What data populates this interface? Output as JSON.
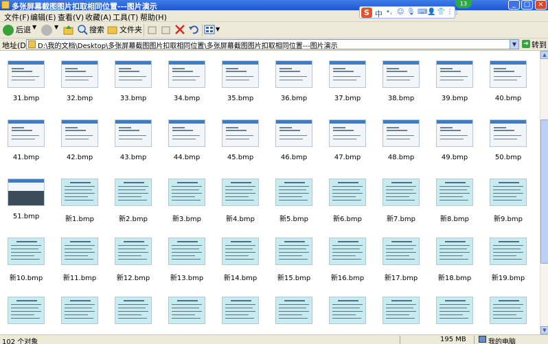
{
  "window": {
    "title": "多张屏幕截图图片扣取相同位置---图片演示",
    "tray_badge": "13",
    "buttons": {
      "minimize": "_",
      "maximize": "□",
      "close": "×"
    }
  },
  "menu": {
    "items": [
      "文件(F)",
      "编辑(E)",
      "查看(V)",
      "收藏(A)",
      "工具(T)",
      "帮助(H)"
    ]
  },
  "ime": {
    "logo": "S",
    "mode": "中",
    "glyphs": [
      "•,",
      "☺",
      "🎙",
      "⌨",
      "👤",
      "👕",
      "⋮⋮"
    ]
  },
  "toolbar": {
    "back": "后退",
    "search": "搜索",
    "folders": "文件夹",
    "views_icon": "views-icon"
  },
  "address": {
    "label": "地址(D)",
    "path": "D:\\我的文档\\Desktop\\多张屏幕截图图片扣取相同位置\\多张屏幕截图图片扣取相同位置---图片演示",
    "go": "转到"
  },
  "files": [
    {
      "name": "31.bmp",
      "kind": "shot"
    },
    {
      "name": "32.bmp",
      "kind": "shot"
    },
    {
      "name": "33.bmp",
      "kind": "shot"
    },
    {
      "name": "34.bmp",
      "kind": "shot"
    },
    {
      "name": "35.bmp",
      "kind": "shot"
    },
    {
      "name": "36.bmp",
      "kind": "shot"
    },
    {
      "name": "37.bmp",
      "kind": "shot"
    },
    {
      "name": "38.bmp",
      "kind": "shot"
    },
    {
      "name": "39.bmp",
      "kind": "shot"
    },
    {
      "name": "40.bmp",
      "kind": "shot"
    },
    {
      "name": "41.bmp",
      "kind": "shot"
    },
    {
      "name": "42.bmp",
      "kind": "shot"
    },
    {
      "name": "43.bmp",
      "kind": "shot"
    },
    {
      "name": "44.bmp",
      "kind": "shot"
    },
    {
      "name": "45.bmp",
      "kind": "shot"
    },
    {
      "name": "46.bmp",
      "kind": "shot"
    },
    {
      "name": "47.bmp",
      "kind": "shot"
    },
    {
      "name": "48.bmp",
      "kind": "shot"
    },
    {
      "name": "49.bmp",
      "kind": "shot"
    },
    {
      "name": "50.bmp",
      "kind": "shot"
    },
    {
      "name": "51.bmp",
      "kind": "dark"
    },
    {
      "name": "新1.bmp",
      "kind": "slide"
    },
    {
      "name": "新2.bmp",
      "kind": "slide"
    },
    {
      "name": "新3.bmp",
      "kind": "slide"
    },
    {
      "name": "新4.bmp",
      "kind": "slide"
    },
    {
      "name": "新5.bmp",
      "kind": "slide"
    },
    {
      "name": "新6.bmp",
      "kind": "slide"
    },
    {
      "name": "新7.bmp",
      "kind": "slide"
    },
    {
      "name": "新8.bmp",
      "kind": "slide"
    },
    {
      "name": "新9.bmp",
      "kind": "slide"
    },
    {
      "name": "新10.bmp",
      "kind": "slide"
    },
    {
      "name": "新11.bmp",
      "kind": "slide"
    },
    {
      "name": "新12.bmp",
      "kind": "slide"
    },
    {
      "name": "新13.bmp",
      "kind": "slide"
    },
    {
      "name": "新14.bmp",
      "kind": "slide"
    },
    {
      "name": "新15.bmp",
      "kind": "slide"
    },
    {
      "name": "新16.bmp",
      "kind": "slide"
    },
    {
      "name": "新17.bmp",
      "kind": "slide"
    },
    {
      "name": "新18.bmp",
      "kind": "slide"
    },
    {
      "name": "新19.bmp",
      "kind": "slide"
    },
    {
      "name": "",
      "kind": "slide"
    },
    {
      "name": "",
      "kind": "slide"
    },
    {
      "name": "",
      "kind": "slide"
    },
    {
      "name": "",
      "kind": "slide"
    },
    {
      "name": "",
      "kind": "slide"
    },
    {
      "name": "",
      "kind": "slide"
    },
    {
      "name": "",
      "kind": "slide"
    },
    {
      "name": "",
      "kind": "slide"
    },
    {
      "name": "",
      "kind": "slide"
    },
    {
      "name": "",
      "kind": "slide"
    }
  ],
  "status": {
    "count": "102 个对象",
    "size": "195 MB",
    "location": "我的电脑"
  }
}
